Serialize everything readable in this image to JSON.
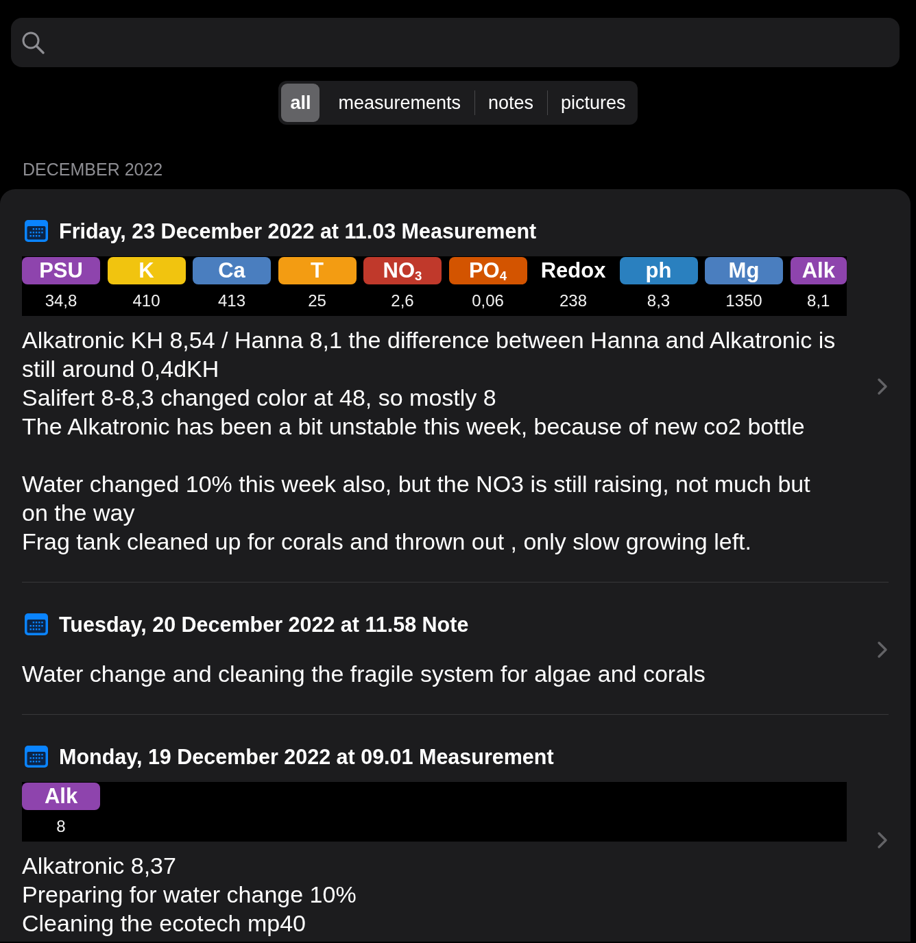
{
  "filter_tabs": [
    {
      "label": "all",
      "selected": true
    },
    {
      "label": "measurements",
      "selected": false
    },
    {
      "label": "notes",
      "selected": false
    },
    {
      "label": "pictures",
      "selected": false
    }
  ],
  "sections": [
    {
      "header": "DECEMBER 2022",
      "entries": [
        {
          "title": "Friday, 23 December 2022 at 11.03 Measurement",
          "measurements": [
            {
              "label": "PSU",
              "value": "34,8",
              "color": "#8e44ad"
            },
            {
              "label": "K",
              "value": "410",
              "color": "#f1c40f"
            },
            {
              "label": "Ca",
              "value": "413",
              "color": "#4a7ebf"
            },
            {
              "label": "T",
              "value": "25",
              "color": "#f39c12"
            },
            {
              "label": "NO$_{3}$",
              "value": "2,6",
              "color": "#c0392b"
            },
            {
              "label": "PO$_{4}$",
              "value": "0,06",
              "color": "#d35400"
            },
            {
              "label": "Redox",
              "value": "238"
            },
            {
              "label": "ph",
              "value": "8,3",
              "color": "#2a80bf"
            },
            {
              "label": "Mg",
              "value": "1350",
              "color": "#4a7ebf"
            },
            {
              "label": "Alk",
              "value": "8,1",
              "color": "#8e44ad"
            }
          ],
          "note": "Alkatronic KH 8,54 / Hanna 8,1 the difference between Hanna and Alkatronic is still around 0,4dKH\nSalifert 8-8,3 changed color at 48, so mostly 8\nThe Alkatronic has been a bit unstable this week, because of new co2 bottle\n\nWater changed 10% this week also, but the NO3 is still raising, not much but on the way\nFrag tank cleaned up for corals and thrown out , only slow growing left."
        },
        {
          "title": "Tuesday, 20 December 2022 at 11.58 Note",
          "note": "Water change and cleaning the fragile system for algae and corals"
        },
        {
          "title": "Monday, 19 December 2022 at 09.01 Measurement",
          "measurements": [
            {
              "label": "Alk",
              "value": "8",
              "color": "#8e44ad"
            }
          ],
          "note": "Alkatronic 8,37\nPreparing for water change 10%\nCleaning the ecotech mp40"
        }
      ]
    }
  ]
}
